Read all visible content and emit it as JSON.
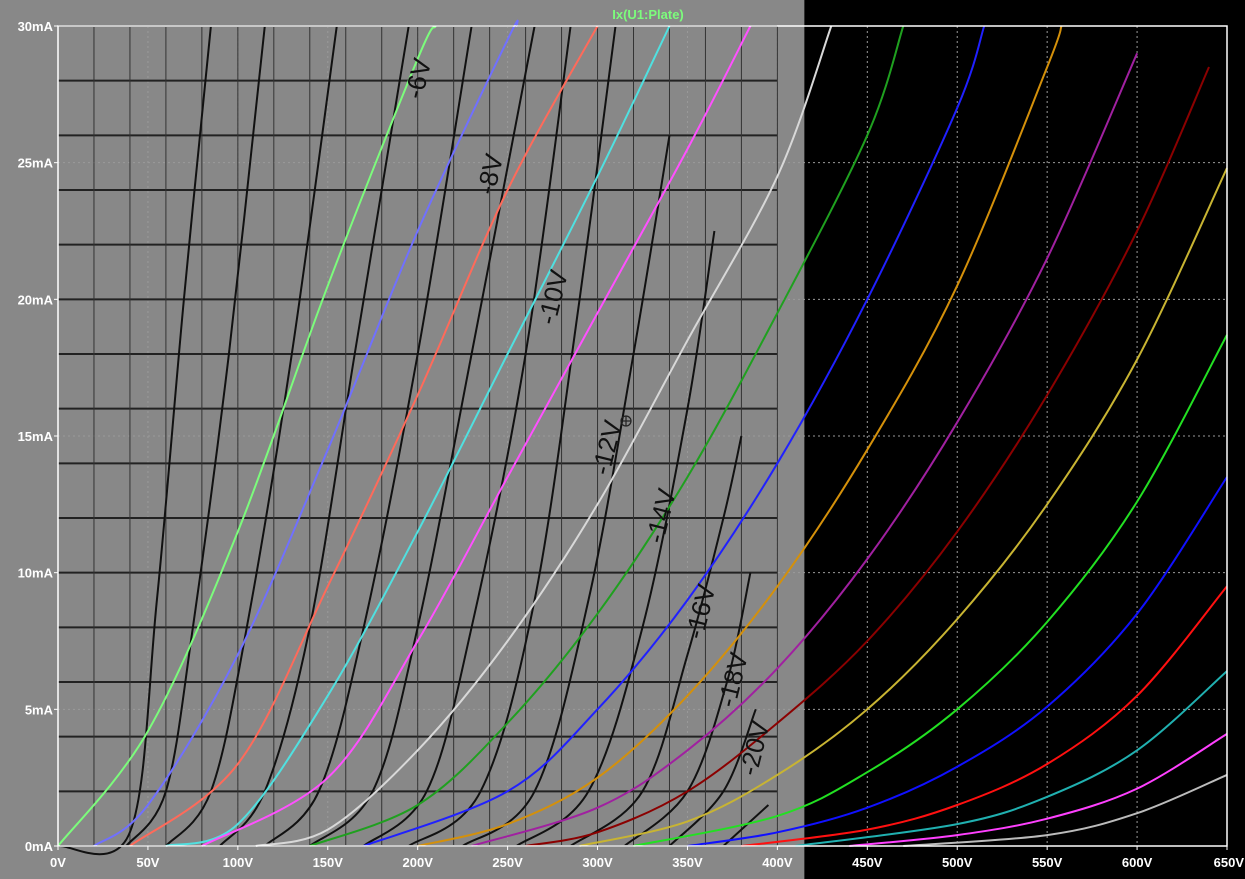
{
  "chart_data": {
    "type": "line",
    "trace_label": "Ix(U1:Plate)",
    "trace_label_color": "#7CFC7C",
    "xlim": [
      0,
      650
    ],
    "ylim": [
      0,
      30
    ],
    "x_ticks": [
      {
        "v": 0,
        "label": "0V"
      },
      {
        "v": 50,
        "label": "50V"
      },
      {
        "v": 100,
        "label": "100V"
      },
      {
        "v": 150,
        "label": "150V"
      },
      {
        "v": 200,
        "label": "200V"
      },
      {
        "v": 250,
        "label": "250V"
      },
      {
        "v": 300,
        "label": "300V"
      },
      {
        "v": 350,
        "label": "350V"
      },
      {
        "v": 400,
        "label": "400V"
      },
      {
        "v": 450,
        "label": "450V"
      },
      {
        "v": 500,
        "label": "500V"
      },
      {
        "v": 550,
        "label": "550V"
      },
      {
        "v": 600,
        "label": "600V"
      },
      {
        "v": 650,
        "label": "650V"
      }
    ],
    "y_ticks": [
      {
        "v": 0,
        "label": "0mA"
      },
      {
        "v": 5,
        "label": "5mA"
      },
      {
        "v": 10,
        "label": "10mA"
      },
      {
        "v": 15,
        "label": "15mA"
      },
      {
        "v": 20,
        "label": "20mA"
      },
      {
        "v": 25,
        "label": "25mA"
      },
      {
        "v": 30,
        "label": "30mA"
      }
    ],
    "grid": true,
    "overlay": {
      "x_range": [
        0,
        415
      ],
      "color": "#888888",
      "curve_color": "#111111",
      "labels": [
        {
          "text": "-6V",
          "x": 205,
          "y": 28
        },
        {
          "text": "-8V",
          "x": 245,
          "y": 24.5
        },
        {
          "text": "-10V",
          "x": 280,
          "y": 20
        },
        {
          "text": "-12V",
          "x": 310,
          "y": 14.5
        },
        {
          "text": "-14V",
          "x": 340,
          "y": 12
        },
        {
          "text": "-16V",
          "x": 362,
          "y": 8.5
        },
        {
          "text": "-18V",
          "x": 380,
          "y": 6
        },
        {
          "text": "-20V",
          "x": 392,
          "y": 3.5
        }
      ],
      "curves": [
        {
          "x": [
            0,
            40,
            55,
            70,
            85
          ],
          "y": [
            0,
            0.5,
            9,
            20,
            30
          ]
        },
        {
          "x": [
            38,
            60,
            75,
            95,
            115
          ],
          "y": [
            0,
            2,
            8,
            18,
            30
          ]
        },
        {
          "x": [
            60,
            85,
            105,
            130,
            155
          ],
          "y": [
            0,
            2,
            8,
            18,
            30
          ]
        },
        {
          "x": [
            90,
            115,
            140,
            165,
            195
          ],
          "y": [
            0,
            2,
            8,
            18,
            30
          ]
        },
        {
          "x": [
            115,
            145,
            170,
            200,
            230
          ],
          "y": [
            0,
            2,
            8,
            18,
            30
          ]
        },
        {
          "x": [
            140,
            175,
            200,
            230,
            265
          ],
          "y": [
            0,
            2,
            8,
            18,
            30
          ]
        },
        {
          "x": [
            170,
            205,
            230,
            260,
            285
          ],
          "y": [
            0,
            2,
            8,
            18,
            30
          ]
        },
        {
          "x": [
            195,
            235,
            265,
            290,
            310
          ],
          "y": [
            0,
            2,
            9,
            20,
            30
          ]
        },
        {
          "x": [
            225,
            265,
            295,
            320,
            340
          ],
          "y": [
            0,
            2,
            9,
            18,
            26
          ]
        },
        {
          "x": [
            255,
            295,
            325,
            350,
            365
          ],
          "y": [
            0,
            2,
            8,
            16,
            22.5
          ]
        },
        {
          "x": [
            285,
            325,
            350,
            370,
            380
          ],
          "y": [
            0,
            2,
            7,
            12,
            15
          ]
        },
        {
          "x": [
            315,
            350,
            372,
            385
          ],
          "y": [
            0,
            2,
            6,
            10
          ]
        },
        {
          "x": [
            340,
            370,
            388
          ],
          "y": [
            0,
            2,
            5
          ]
        },
        {
          "x": [
            370,
            395
          ],
          "y": [
            0,
            1.5
          ]
        }
      ]
    },
    "series": [
      {
        "color": "#7CFC7C",
        "x": [
          0,
          50,
          100,
          150,
          200,
          210
        ],
        "y": [
          0,
          4.2,
          11.5,
          20.5,
          28.8,
          30
        ]
      },
      {
        "color": "#7070FF",
        "x": [
          20,
          50,
          100,
          150,
          200,
          250,
          255
        ],
        "y": [
          0,
          1.5,
          7,
          14.5,
          22.5,
          29.5,
          30
        ]
      },
      {
        "color": "#FF6A5A",
        "x": [
          40,
          100,
          150,
          200,
          250,
          300
        ],
        "y": [
          0,
          3,
          9.5,
          16.5,
          24,
          30
        ]
      },
      {
        "color": "#50E0E0",
        "x": [
          60,
          100,
          150,
          200,
          250,
          300,
          340
        ],
        "y": [
          0,
          0.8,
          5.5,
          11.5,
          18,
          24.5,
          30
        ]
      },
      {
        "color": "#FF50FF",
        "x": [
          80,
          150,
          200,
          250,
          300,
          350,
          385
        ],
        "y": [
          0,
          2.5,
          7.5,
          13.5,
          19.5,
          25.5,
          30
        ]
      },
      {
        "color": "#D8D8D8",
        "x": [
          110,
          150,
          200,
          250,
          300,
          350,
          400,
          430
        ],
        "y": [
          0,
          0.6,
          3.5,
          7.5,
          12.5,
          18.5,
          24.5,
          30
        ]
      },
      {
        "color": "#1FA01F",
        "x": [
          140,
          200,
          250,
          300,
          350,
          400,
          450,
          470
        ],
        "y": [
          0,
          1.5,
          4.5,
          8.5,
          13.5,
          19.5,
          26,
          30
        ]
      },
      {
        "color": "#2020FF",
        "x": [
          170,
          250,
          300,
          350,
          400,
          450,
          500,
          515
        ],
        "y": [
          0,
          2,
          5,
          9,
          14,
          20,
          27,
          30
        ]
      },
      {
        "color": "#D4900A",
        "x": [
          200,
          250,
          300,
          350,
          400,
          450,
          500,
          550,
          558
        ],
        "y": [
          0,
          0.8,
          2.5,
          5.5,
          9.5,
          14.5,
          20.5,
          28.5,
          30
        ]
      },
      {
        "color": "#A020A0",
        "x": [
          230,
          300,
          350,
          400,
          450,
          500,
          550,
          600
        ],
        "y": [
          0,
          1.4,
          3.5,
          6.5,
          10.5,
          15.5,
          21.5,
          29
        ]
      },
      {
        "color": "#8B0000",
        "x": [
          260,
          300,
          350,
          400,
          450,
          500,
          550,
          600,
          640
        ],
        "y": [
          0,
          0.5,
          2,
          4.5,
          7.5,
          11.5,
          16.5,
          22.5,
          28.5
        ]
      },
      {
        "color": "#C8B432",
        "x": [
          290,
          350,
          400,
          450,
          500,
          550,
          600,
          650
        ],
        "y": [
          0,
          0.9,
          2.6,
          5,
          8.3,
          12.5,
          17.8,
          24.8
        ]
      },
      {
        "color": "#22E022",
        "x": [
          320,
          400,
          450,
          500,
          550,
          600,
          650
        ],
        "y": [
          0,
          1.1,
          2.7,
          5,
          8.2,
          12.6,
          18.7
        ]
      },
      {
        "color": "#1010FF",
        "x": [
          350,
          400,
          450,
          500,
          550,
          600,
          650
        ],
        "y": [
          0,
          0.5,
          1.4,
          2.9,
          5.1,
          8.5,
          13.5
        ]
      },
      {
        "color": "#FF1010",
        "x": [
          380,
          450,
          500,
          550,
          600,
          650
        ],
        "y": [
          0,
          0.6,
          1.5,
          3,
          5.5,
          9.5
        ]
      },
      {
        "color": "#20B0B0",
        "x": [
          410,
          500,
          550,
          600,
          650
        ],
        "y": [
          0,
          0.8,
          1.8,
          3.5,
          6.4
        ]
      },
      {
        "color": "#FF40FF",
        "x": [
          440,
          500,
          550,
          600,
          650
        ],
        "y": [
          0,
          0.4,
          1,
          2.1,
          4.1
        ]
      },
      {
        "color": "#BBBBBB",
        "x": [
          470,
          550,
          600,
          650
        ],
        "y": [
          0,
          0.4,
          1.2,
          2.6
        ]
      }
    ]
  }
}
